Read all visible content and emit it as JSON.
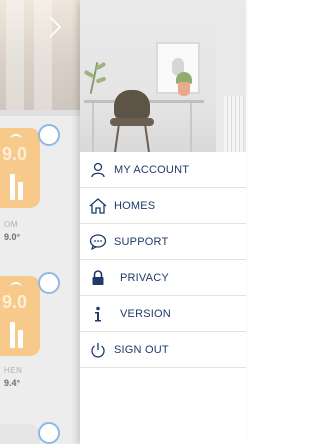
{
  "background": {
    "rooms": [
      {
        "temp_display": "9.0",
        "label": "OM",
        "temp": "9.0°"
      },
      {
        "temp_display": "9.0",
        "label": "HEN",
        "temp": "9.4°"
      }
    ]
  },
  "drawer": {
    "menu": [
      {
        "label": "MY ACCOUNT",
        "icon": "user-icon"
      },
      {
        "label": "HOMES",
        "icon": "home-icon"
      },
      {
        "label": "SUPPORT",
        "icon": "chat-support-icon"
      },
      {
        "label": "PRIVACY",
        "icon": "lock-icon"
      },
      {
        "label": "VERSION",
        "icon": "info-icon"
      },
      {
        "label": "SIGN OUT",
        "icon": "power-icon"
      }
    ]
  },
  "colors": {
    "accent": "#1f3a68",
    "card": "#f7c98b",
    "circle_border": "#8fb9e4"
  }
}
